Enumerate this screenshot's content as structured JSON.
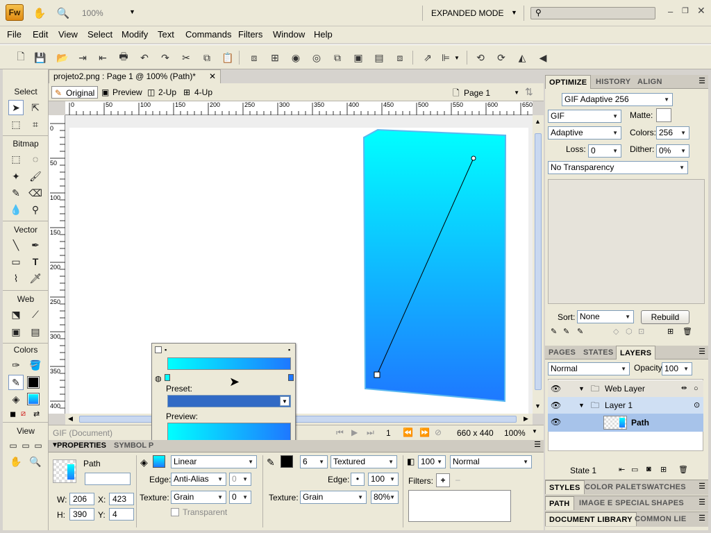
{
  "app": {
    "logo": "Fw",
    "zoom": "100%",
    "mode": "EXPANDED MODE",
    "search_placeholder": ""
  },
  "menu": [
    "File",
    "Edit",
    "View",
    "Select",
    "Modify",
    "Text",
    "Commands",
    "Filters",
    "Window",
    "Help"
  ],
  "document": {
    "tab_title": "projeto2.png : Page 1 @ 100% (Path)*",
    "view_modes": [
      "Original",
      "Preview",
      "2-Up",
      "4-Up"
    ],
    "page": "Page 1"
  },
  "tools": {
    "select": "Select",
    "bitmap": "Bitmap",
    "vector": "Vector",
    "web": "Web",
    "colors": "Colors",
    "view": "View"
  },
  "ruler": {
    "top": [
      "0",
      "50",
      "100",
      "150",
      "200",
      "250",
      "300",
      "350",
      "400",
      "450",
      "500",
      "550",
      "600",
      "650"
    ],
    "left": [
      "0",
      "50",
      "100",
      "150",
      "200",
      "250",
      "300",
      "350",
      "400"
    ]
  },
  "status": {
    "format": "GIF (Document)",
    "frame": "1",
    "size": "660 x 440",
    "zoom": "100%"
  },
  "gradient_popup": {
    "preset_label": "Preset:",
    "preview_label": "Preview:"
  },
  "properties": {
    "tabs": [
      "PROPERTIES",
      "SYMBOL P"
    ],
    "object_name": "Path",
    "name_value": "",
    "w": "206",
    "x": "423",
    "h": "390",
    "y": "4",
    "fill_type": "Linear",
    "edge_label": "Edge:",
    "edge": "Anti-Alias",
    "edge_val": "0",
    "texture_label": "Texture:",
    "texture": "Grain",
    "texture_val": "0",
    "transparent_label": "Transparent",
    "stroke_size": "6",
    "stroke_type": "Textured",
    "stroke_edge_label": "Edge:",
    "stroke_edge_val": "100",
    "stroke_texture_label": "Texture:",
    "stroke_texture": "Grain",
    "stroke_texture_val": "80%",
    "opacity": "100",
    "blend": "Normal",
    "filters_label": "Filters:",
    "w_label": "W:",
    "x_label": "X:",
    "h_label": "H:",
    "y_label": "Y:"
  },
  "optimize": {
    "tabs": [
      "OPTIMIZE",
      "HISTORY",
      "ALIGN"
    ],
    "preset": "GIF Adaptive 256",
    "format": "GIF",
    "matte_label": "Matte:",
    "palette": "Adaptive",
    "colors_label": "Colors:",
    "colors": "256",
    "loss_label": "Loss:",
    "loss": "0",
    "dither_label": "Dither:",
    "dither": "0%",
    "transparency": "No Transparency",
    "sort_label": "Sort:",
    "sort": "None",
    "rebuild": "Rebuild"
  },
  "layers": {
    "tabs": [
      "PAGES",
      "STATES",
      "LAYERS"
    ],
    "blend": "Normal",
    "opacity_label": "Opacity",
    "opacity": "100",
    "rows": [
      "Web Layer",
      "Layer 1",
      "Path"
    ],
    "state": "State 1"
  },
  "bottom_tabs": {
    "row1": [
      "STYLES",
      "COLOR PALET",
      "SWATCHES"
    ],
    "row2": [
      "PATH",
      "IMAGE E",
      "SPECIAL",
      "SHAPES"
    ],
    "row3": [
      "DOCUMENT LIBRARY",
      "COMMON LIE"
    ]
  },
  "colors": {
    "gradient_top": "#00ffff",
    "gradient_bottom": "#1e78ff",
    "stroke": "#000000"
  }
}
